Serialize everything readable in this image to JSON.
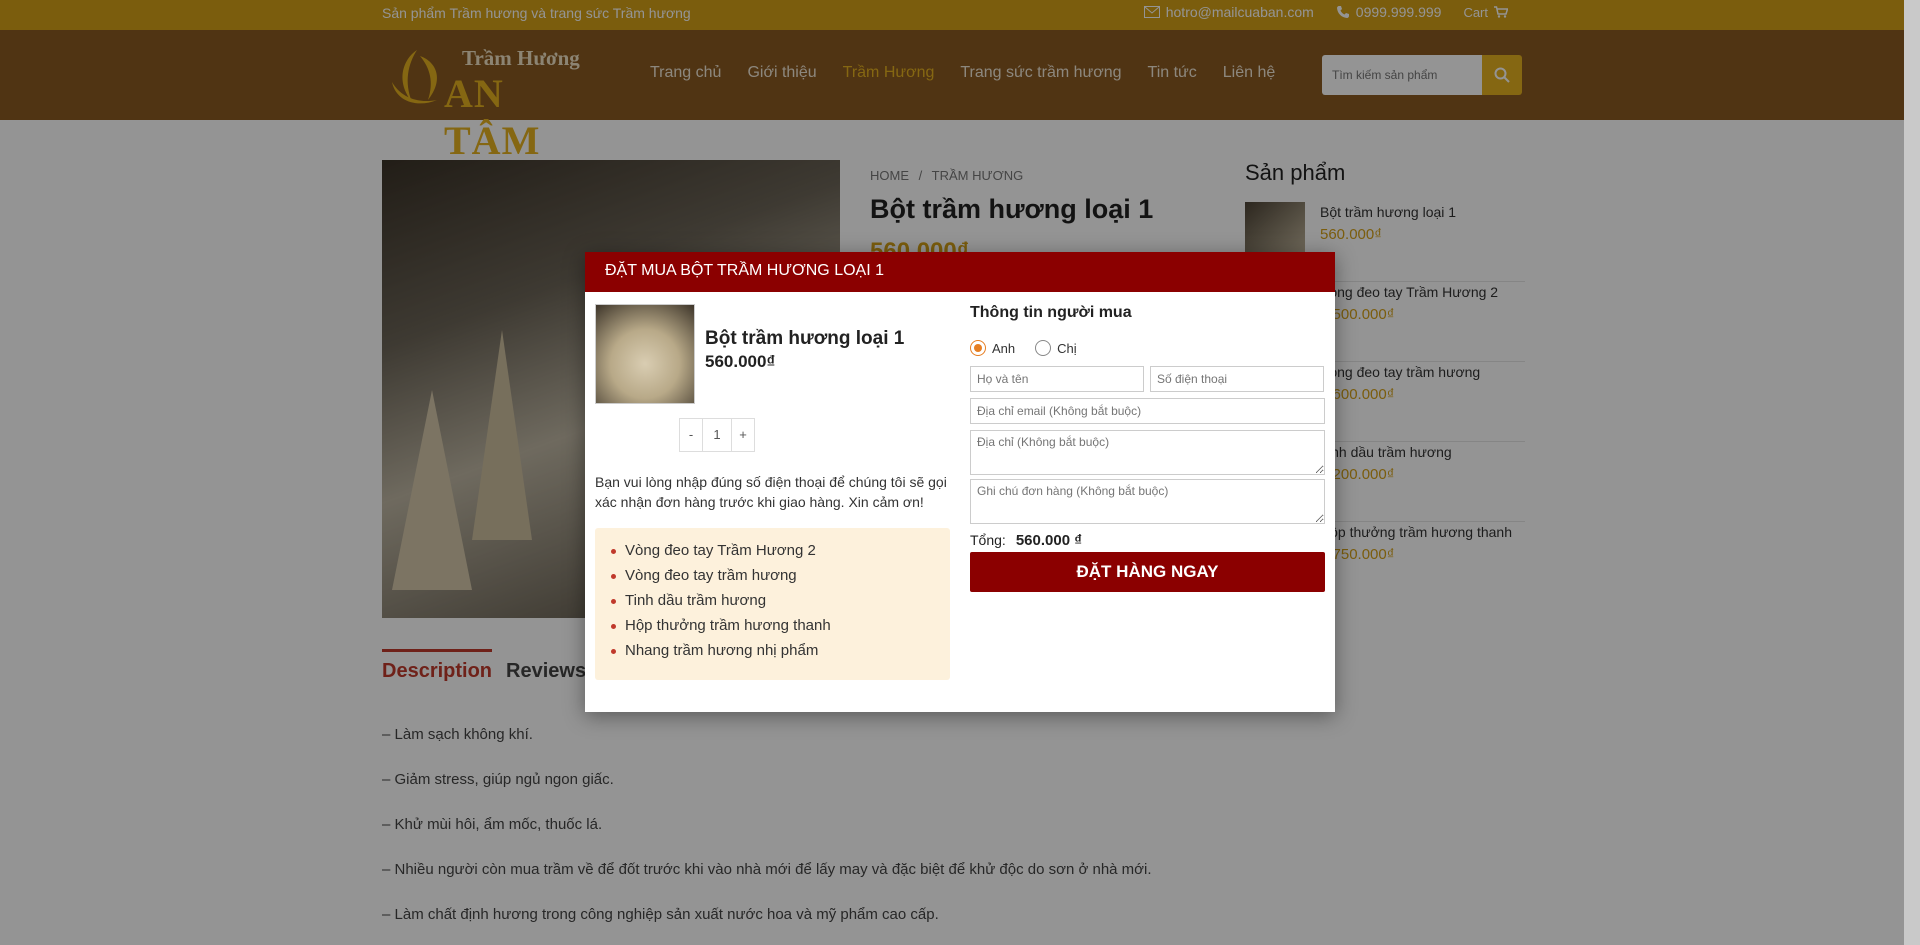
{
  "topbar": {
    "tagline": "Sản phẩm Trầm hương và trang sức Trầm hương",
    "email": "hotro@mailcuaban.com",
    "phone": "0999.999.999",
    "cart": "Cart"
  },
  "logo": {
    "line1": "Trầm Hương",
    "line2": "AN TÂM"
  },
  "nav": [
    "Trang chủ",
    "Giới thiệu",
    "Trầm Hương",
    "Trang sức trầm hương",
    "Tin tức",
    "Liên hệ"
  ],
  "search": {
    "placeholder": "Tìm kiếm sản phẩm"
  },
  "product": {
    "breadcrumb_home": "HOME",
    "breadcrumb_sep": "/",
    "breadcrumb_cat": "TRẦM HƯƠNG",
    "title": "Bột trầm hương loại 1",
    "price": "560.000₫"
  },
  "sidebar": {
    "title": "Sản phẩm",
    "items": [
      {
        "name": "Bột trầm hương loại 1",
        "price": "560.000₫"
      },
      {
        "name": "Vòng đeo tay Trầm Hương 2",
        "price": "1.500.000₫"
      },
      {
        "name": "Vòng đeo tay trầm hương",
        "price": "1.600.000₫"
      },
      {
        "name": "Tinh dầu trầm hương",
        "price": "1.200.000₫"
      },
      {
        "name": "Hộp thưởng trầm hương thanh",
        "price": "1.750.000₫"
      }
    ]
  },
  "tabs": {
    "description": "Description",
    "reviews": "Reviews (0)"
  },
  "description": [
    "– Làm sạch không khí.",
    "– Giảm stress, giúp ngủ ngon giấc.",
    "– Khử mùi hôi, ẩm mốc, thuốc lá.",
    "– Nhiều người còn mua trầm về để đốt trước khi vào nhà mới để lấy may và đặc biệt để khử độc do sơn ở nhà mới.",
    "– Làm chất định hương trong công nghiệp sản xuất nước hoa và mỹ phẩm cao cấp."
  ],
  "modal": {
    "header": "ĐẶT MUA BỘT TRẦM HƯƠNG LOẠI 1",
    "product_title": "Bột trầm hương loại 1",
    "product_price": "560.000₫",
    "qty_minus": "-",
    "qty_value": "1",
    "qty_plus": "+",
    "note": "Bạn vui lòng nhập đúng số điện thoại để chúng tôi sẽ gọi xác nhận đơn hàng trước khi giao hàng. Xin cảm ơn!",
    "related": [
      "Vòng đeo tay Trầm Hương 2",
      "Vòng đeo tay trầm hương",
      "Tinh dầu trầm hương",
      "Hộp thưởng trầm hương thanh",
      "Nhang trầm hương nhị phẩm"
    ],
    "form_title": "Thông tin người mua",
    "gender_male": "Anh",
    "gender_female": "Chị",
    "name_placeholder": "Họ và tên",
    "phone_placeholder": "Số điện thoại",
    "email_placeholder": "Địa chỉ email (Không bắt buộc)",
    "address_placeholder": "Địa chỉ (Không bắt buộc)",
    "note_placeholder": "Ghi chú đơn hàng (Không bắt buộc)",
    "total_label": "Tổng:",
    "total_value": "560.000 ₫",
    "order_button": "ĐẶT HÀNG NGAY"
  },
  "colors": {
    "topbar": "#d4a017",
    "header": "#8a5a22",
    "accent": "#8b0000",
    "gold": "#e6b21f"
  }
}
